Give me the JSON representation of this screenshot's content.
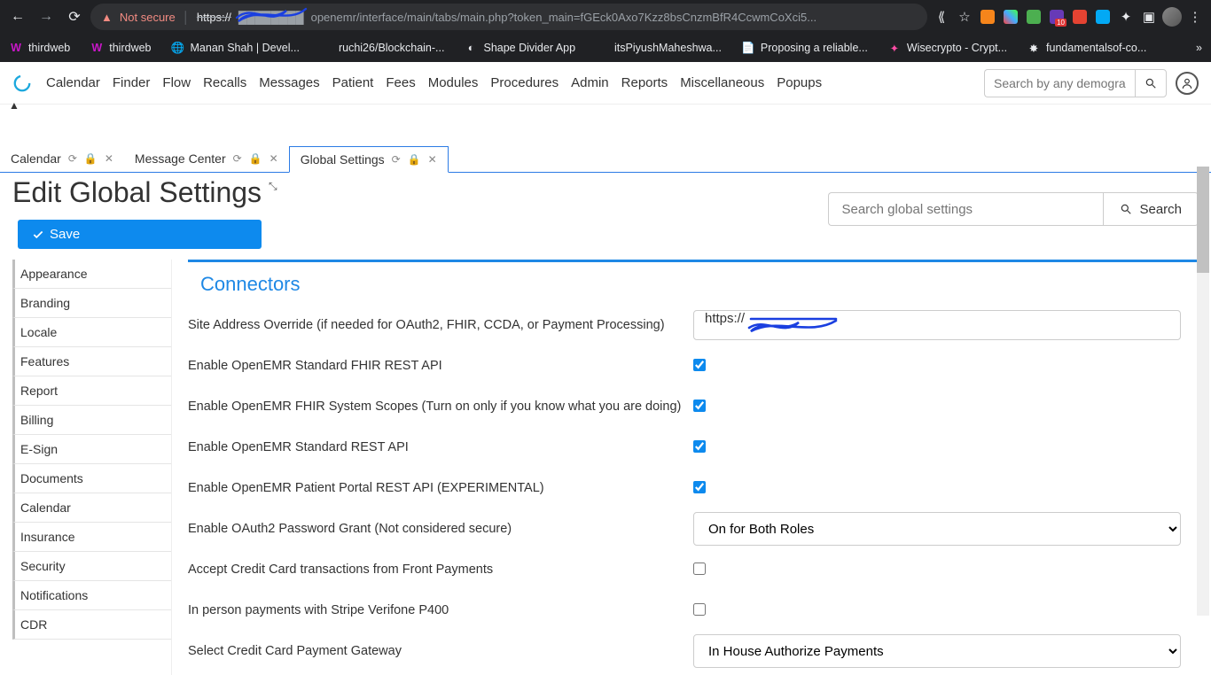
{
  "browser": {
    "not_secure": "Not secure",
    "url_prefix_strike": "https://",
    "url_rest": "openemr/interface/main/tabs/main.php?token_main=fGEck0Axo7Kzz8bsCnzmBfR4CcwmCoXci5...",
    "bookmarks": [
      "thirdweb",
      "thirdweb",
      "Manan Shah | Devel...",
      "ruchi26/Blockchain-...",
      "Shape Divider App",
      "itsPiyushMaheshwa...",
      "Proposing a reliable...",
      "Wisecrypto - Crypt...",
      "fundamentalsof-co..."
    ]
  },
  "emr_menu": [
    "Calendar",
    "Finder",
    "Flow",
    "Recalls",
    "Messages",
    "Patient",
    "Fees",
    "Modules",
    "Procedures",
    "Admin",
    "Reports",
    "Miscellaneous",
    "Popups"
  ],
  "top_search_placeholder": "Search by any demograph",
  "tabs": {
    "calendar": "Calendar",
    "message_center": "Message Center",
    "global_settings": "Global Settings"
  },
  "page": {
    "title": "Edit Global Settings",
    "save": "Save",
    "search_placeholder": "Search global settings",
    "search_btn": "Search"
  },
  "sidenav": [
    "Appearance",
    "Branding",
    "Locale",
    "Features",
    "Report",
    "Billing",
    "E-Sign",
    "Documents",
    "Calendar",
    "Insurance",
    "Security",
    "Notifications",
    "CDR"
  ],
  "section_title": "Connectors",
  "fields": {
    "site_addr_label": "Site Address Override (if needed for OAuth2, FHIR, CCDA, or Payment Processing)",
    "site_addr_value_prefix": "https://",
    "fhir_std": "Enable OpenEMR Standard FHIR REST API",
    "fhir_scopes": "Enable OpenEMR FHIR System Scopes (Turn on only if you know what you are doing)",
    "rest_std": "Enable OpenEMR Standard REST API",
    "portal_api": "Enable OpenEMR Patient Portal REST API (EXPERIMENTAL)",
    "oauth_pw": "Enable OAuth2 Password Grant (Not considered secure)",
    "oauth_pw_value": "On for Both Roles",
    "accept_cc": "Accept Credit Card transactions from Front Payments",
    "stripe_p400": "In person payments with Stripe Verifone P400",
    "cc_gateway": "Select Credit Card Payment Gateway",
    "cc_gateway_value": "In House Authorize Payments"
  }
}
